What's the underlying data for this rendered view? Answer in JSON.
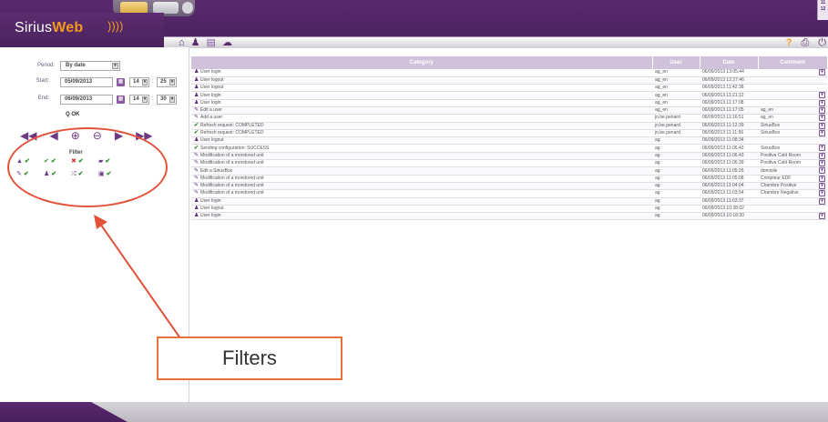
{
  "header": {
    "logo_prefix": "Sirius",
    "logo_accent": "Web",
    "logo_waves": "))))",
    "accent_color": "#f39a1e",
    "brand_color": "#5a2a6e",
    "nav_icons": [
      "home-icon",
      "users-icon",
      "logs-icon",
      "settings-icon"
    ],
    "right_icons": [
      "help-icon",
      "print-icon",
      "power-icon"
    ],
    "help_glyph": "?",
    "calendar_widget_text": [
      "11",
      "12"
    ]
  },
  "filters_panel": {
    "period_label": "Period:",
    "period_value": "By date",
    "start_label": "Start:",
    "start_date": "05/09/2013",
    "start_hour": "14",
    "start_minute": "25",
    "end_label": "End:",
    "end_date": "06/09/2013",
    "end_hour": "14",
    "end_minute": "30",
    "time_separator": ":",
    "ok_label": "OK",
    "filter_title": "Filter",
    "media_controls": [
      "fast-backward-icon",
      "step-back-icon",
      "zoom-in-icon",
      "zoom-out-icon",
      "step-forward-icon",
      "fast-forward-icon"
    ]
  },
  "table": {
    "columns": [
      "Category",
      "User",
      "Date",
      "Comment"
    ],
    "rows": [
      {
        "icon": "user",
        "category": "User login",
        "user": "ag_en",
        "date": "06/09/2013 13:05:44",
        "comment": "",
        "dl": true
      },
      {
        "icon": "user",
        "category": "User logout",
        "user": "ag_en",
        "date": "06/09/2013 12:27:46",
        "comment": "",
        "dl": false
      },
      {
        "icon": "user",
        "category": "User logout",
        "user": "ag_en",
        "date": "06/09/2013 11:42:38",
        "comment": "",
        "dl": false
      },
      {
        "icon": "user",
        "category": "User login",
        "user": "ag_en",
        "date": "06/09/2013 11:21:12",
        "comment": "",
        "dl": true
      },
      {
        "icon": "user",
        "category": "User login",
        "user": "ag_en",
        "date": "06/09/2013 11:17:08",
        "comment": "",
        "dl": true
      },
      {
        "icon": "wrench",
        "category": "Edit a user",
        "user": "ag_en",
        "date": "06/09/2013 11:17:05",
        "comment": "ag_en",
        "dl": true
      },
      {
        "icon": "wrench",
        "category": "Add a user",
        "user": "jn.be.penard",
        "date": "06/09/2013 11:16:51",
        "comment": "ag_en",
        "dl": true
      },
      {
        "icon": "check",
        "category": "Refresh request: COMPLETED",
        "user": "jn.be.penard",
        "date": "06/09/2013 11:12:39",
        "comment": "SiriusBox",
        "dl": true
      },
      {
        "icon": "check",
        "category": "Refresh request: COMPLETED",
        "user": "jn.be.penard",
        "date": "06/09/2013 11:11:56",
        "comment": "SiriusBox",
        "dl": true
      },
      {
        "icon": "user",
        "category": "User logout",
        "user": "ag",
        "date": "06/09/2013 11:08:34",
        "comment": "",
        "dl": false
      },
      {
        "icon": "check",
        "category": "Sending configuration: SUCCESS",
        "user": "ag",
        "date": "06/09/2013 11:06:43",
        "comment": "SiriusBox",
        "dl": true
      },
      {
        "icon": "wrench",
        "category": "Modification of a monitored unit",
        "user": "ag",
        "date": "06/09/2013 11:06:43",
        "comment": "Positive Cold Room",
        "dl": true
      },
      {
        "icon": "wrench",
        "category": "Modification of a monitored unit",
        "user": "ag",
        "date": "06/09/2013 11:06:39",
        "comment": "Positive Cold Room",
        "dl": true
      },
      {
        "icon": "wrench",
        "category": "Edit a SiriusBox",
        "user": "ag",
        "date": "06/09/2013 11:05:26",
        "comment": "domicile",
        "dl": true
      },
      {
        "icon": "wrench",
        "category": "Modification of a monitored unit",
        "user": "ag",
        "date": "06/09/2013 11:05:08",
        "comment": "Compteur EDF",
        "dl": true
      },
      {
        "icon": "wrench",
        "category": "Modification of a monitored unit",
        "user": "ag",
        "date": "06/09/2013 11:04:04",
        "comment": "Chambre Positive",
        "dl": true
      },
      {
        "icon": "wrench",
        "category": "Modification of a monitored unit",
        "user": "ag",
        "date": "06/09/2013 11:03:54",
        "comment": "Chambre Negative",
        "dl": true
      },
      {
        "icon": "user",
        "category": "User login",
        "user": "ag",
        "date": "06/09/2013 11:03:37",
        "comment": "",
        "dl": true
      },
      {
        "icon": "user",
        "category": "User logout",
        "user": "ag",
        "date": "06/09/2013 10:38:02",
        "comment": "",
        "dl": false
      },
      {
        "icon": "user",
        "category": "User login",
        "user": "ag",
        "date": "06/09/2013 10:18:30",
        "comment": "",
        "dl": true
      }
    ]
  },
  "annotation": {
    "label": "Filters",
    "color": "#e0533a"
  }
}
